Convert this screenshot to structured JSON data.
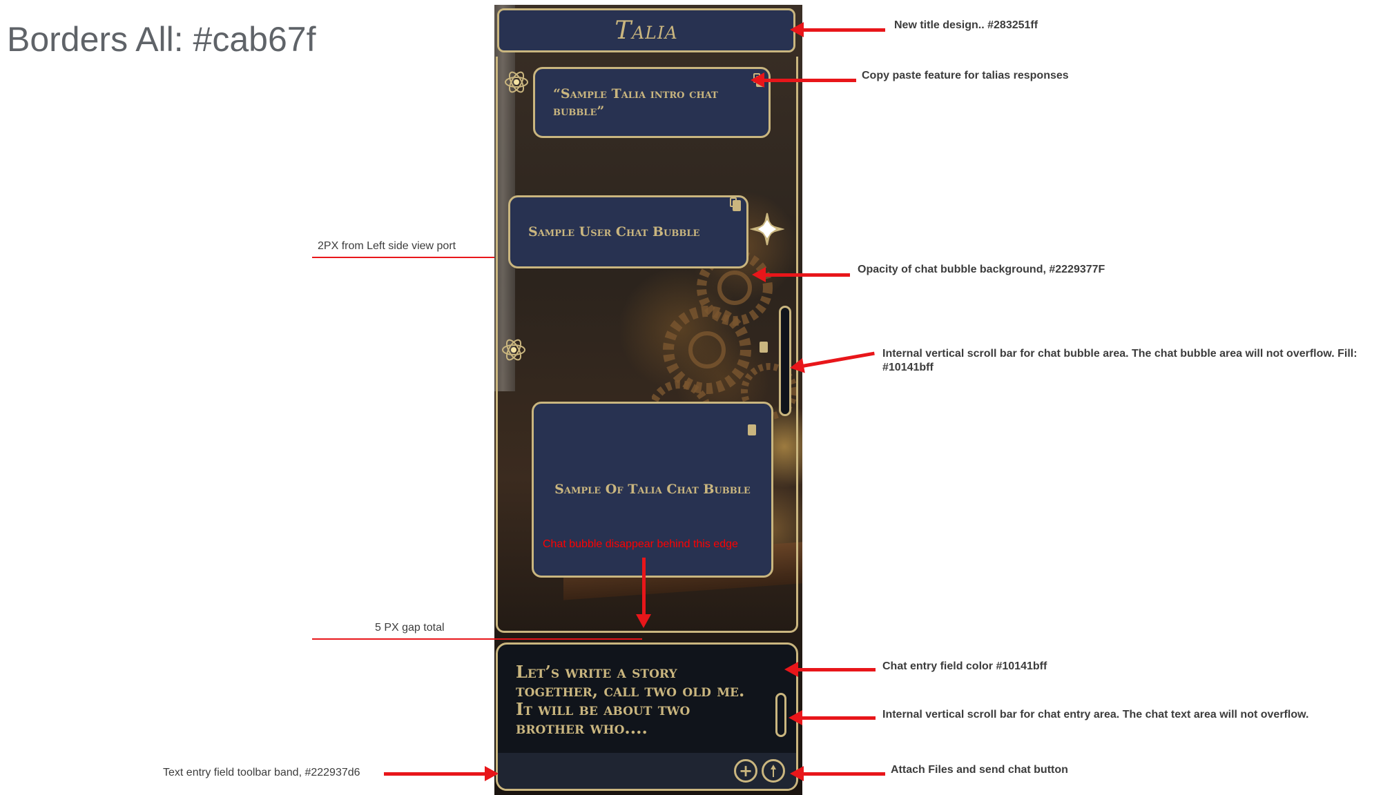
{
  "heading": "Borders All: #cab67f",
  "app": {
    "title": "Talia",
    "bubbles": [
      {
        "text": "“Sample Talia intro chat bubble”"
      },
      {
        "text": "Sample User Chat Bubble"
      },
      {
        "text": "Sample Of Talia Chat Bubble"
      }
    ],
    "edge_note": "Chat bubble disappear behind this edge",
    "entry_text": "Let’s write a story together, call two old me.  It will be about two brother who....",
    "attach_icon": "plus-circle-icon",
    "send_icon": "send-icon"
  },
  "colors": {
    "border": "#cab67f",
    "title_bg": "#283251ff",
    "bubble_bg": "#2229377F",
    "scrollbar_fill": "#10141bff",
    "entry_bg": "#10141bff",
    "toolbar_band": "#222937d6",
    "annotation_red": "#e8161a"
  },
  "annotations": {
    "title_design": "New title design.. #283251ff",
    "copy_paste": "Copy paste feature for talias responses",
    "left_gap": "2PX from Left side view port",
    "bubble_opacity": "Opacity of chat bubble background, #2229377F",
    "chat_scroll": "Internal vertical scroll bar for chat bubble area. The chat bubble area will not overflow. Fill: #10141bff",
    "gap_total": "5 PX gap total",
    "entry_color": "Chat entry field color #10141bff",
    "entry_scroll": "Internal vertical scroll bar for chat entry area. The chat text area will not overflow.",
    "toolbar_band": "Text entry field toolbar band, #222937d6",
    "attach_send": "Attach Files and send chat button"
  }
}
